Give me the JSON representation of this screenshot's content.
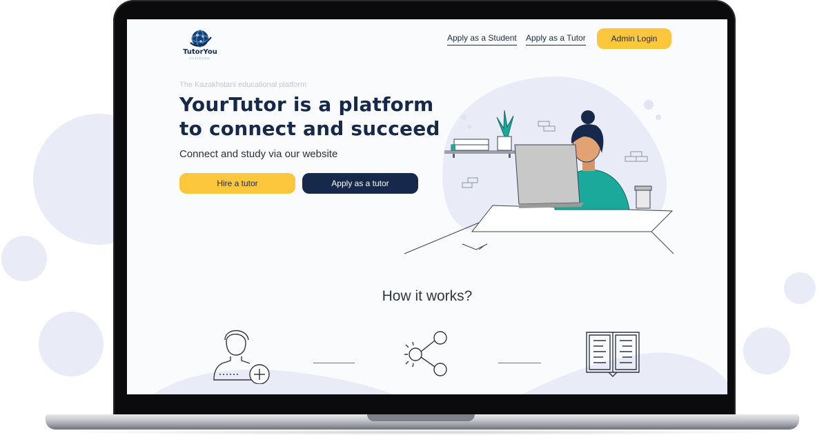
{
  "logo": {
    "name": "TutorYou",
    "sub": "PLATFORM"
  },
  "nav": {
    "student_link": "Apply as a Student",
    "tutor_link": "Apply as a Tutor",
    "admin_button": "Admin Login"
  },
  "hero": {
    "eyebrow": "The Kazakhstani educational platform",
    "title_line1": "YourTutor is a platform",
    "title_line2": "to connect and succeed",
    "subtitle": "Connect and study via our website",
    "hire_button": "Hire a tutor",
    "apply_button": "Apply as a tutor"
  },
  "how": {
    "title": "How it works?",
    "steps": [
      {
        "icon": "add-user-icon"
      },
      {
        "icon": "share-icon"
      },
      {
        "icon": "open-book-icon"
      }
    ]
  },
  "colors": {
    "accent_yellow": "#fcc63d",
    "navy": "#16294a",
    "blob": "#e9ecf6",
    "teal": "#1aa99b"
  }
}
